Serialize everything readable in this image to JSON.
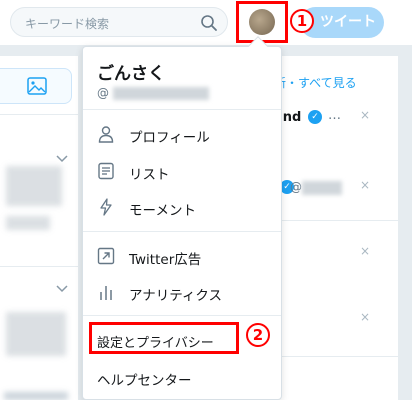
{
  "search": {
    "placeholder": "キーワード検索"
  },
  "header": {
    "tweet_label": "ツイート"
  },
  "annotations": {
    "badge1": "1",
    "badge2": "2"
  },
  "menu": {
    "user_name": "ごんさく",
    "user_handle": "@",
    "items": [
      {
        "label": "プロフィール",
        "icon": "person-icon"
      },
      {
        "label": "リスト",
        "icon": "list-icon"
      },
      {
        "label": "モーメント",
        "icon": "lightning-icon"
      },
      {
        "label": "Twitter広告",
        "icon": "external-arrow-icon"
      },
      {
        "label": "アナリティクス",
        "icon": "bar-chart-icon"
      },
      {
        "label": "設定とプライバシー",
        "icon": ""
      },
      {
        "label": "ヘルプセンター",
        "icon": ""
      }
    ]
  },
  "sidebar_right": {
    "header_text": "新・すべて見る",
    "card1_name": "and",
    "card1_more": "…",
    "card2_handle": "@",
    "close": "×"
  },
  "colors": {
    "accent": "#1da1f2",
    "highlight": "#ff0000",
    "tweet_button": "#a9d8fa"
  }
}
